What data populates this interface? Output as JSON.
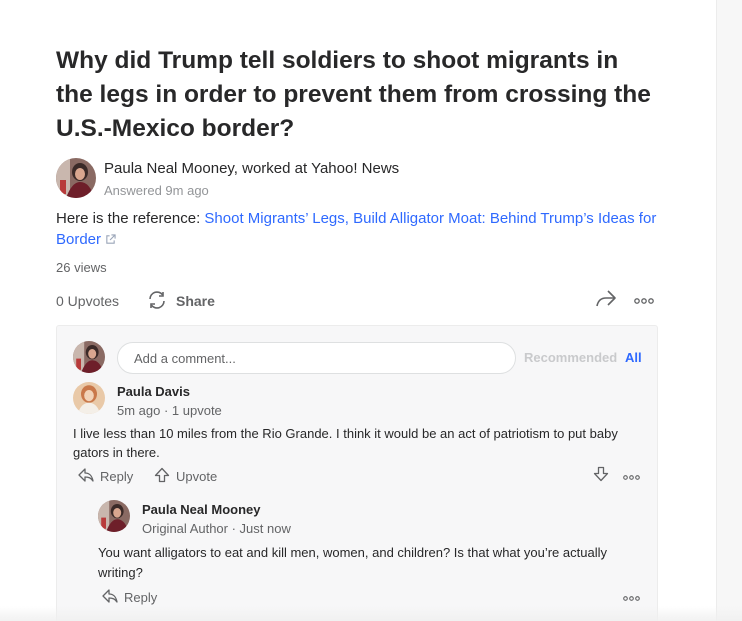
{
  "question": {
    "title": "Why did Trump tell soldiers to shoot migrants in the legs in order to prevent them from crossing the U.S.-Mexico border?"
  },
  "answer": {
    "author": "Paula Neal Mooney, worked at Yahoo! News",
    "answered": "Answered 9m ago",
    "text_prefix": "Here is the reference: ",
    "link_text": "Shoot Migrants’ Legs, Build Alligator Moat: Behind Trump’s Ideas for Border",
    "views": "26 views",
    "upvotes": "0 Upvotes",
    "share_label": "Share"
  },
  "comments": {
    "input_placeholder": "Add a comment...",
    "sort_recommended": "Recommended",
    "sort_all": "All",
    "items": [
      {
        "name": "Paula Davis",
        "meta": "5m ago · 1 upvote",
        "text": "I live less than 10 miles from the Rio Grande. I think it would be an act of patriotism to put baby gators in there.",
        "reply_label": "Reply",
        "upvote_label": "Upvote"
      },
      {
        "name": "Paula Neal Mooney",
        "meta": "Original Author · Just now",
        "text": "You want alligators to eat and kill men, women, and children? Is that what you’re actually writing?",
        "reply_label": "Reply"
      }
    ]
  },
  "colors": {
    "link": "#2e69ff",
    "text": "#282829",
    "secondary": "#636466",
    "panel_bg": "#f7f7f8"
  }
}
